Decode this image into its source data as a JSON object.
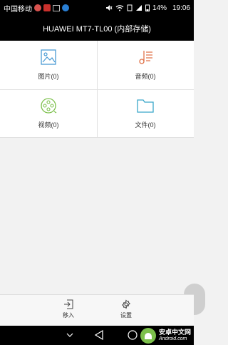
{
  "status_bar": {
    "carrier": "中国移动",
    "battery": "14%",
    "time": "19:06",
    "icons": [
      "app-notification-icon",
      "z-app-icon",
      "image-icon",
      "bluetooth-icon",
      "mute-icon",
      "wifi-icon",
      "sim-icon",
      "signal-icon",
      "battery-icon"
    ]
  },
  "title": "HUAWEI MT7-TL00 (内部存储)",
  "categories": [
    {
      "label": "图片(0)",
      "icon": "picture-icon",
      "color": "#4a9bd4"
    },
    {
      "label": "音频(0)",
      "icon": "music-icon",
      "color": "#e0734a"
    },
    {
      "label": "视频(0)",
      "icon": "video-icon",
      "color": "#7cc04b"
    },
    {
      "label": "文件(0)",
      "icon": "folder-icon",
      "color": "#3aa7c9"
    }
  ],
  "bottom_bar": {
    "move_in": "移入",
    "settings": "设置"
  },
  "watermark": {
    "cn": "安卓中文网",
    "en": "Android.com"
  }
}
